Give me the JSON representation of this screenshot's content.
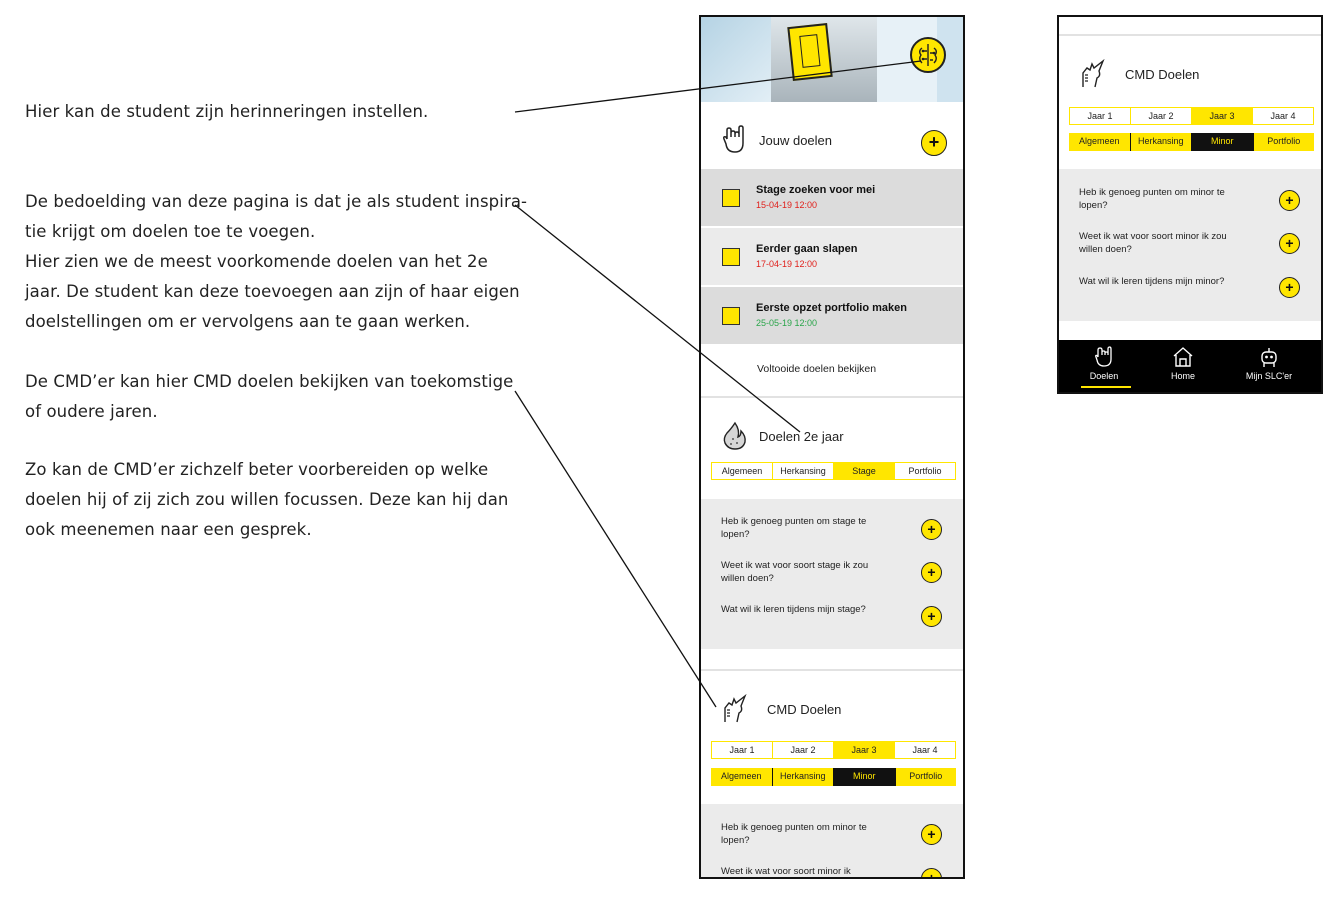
{
  "notes": {
    "n1": [
      "Hier kan de student zijn herinneringen instellen."
    ],
    "n2": [
      "De bedoelding van deze pagina is dat je als student inspira-",
      "tie krijgt om doelen toe te voegen.",
      "Hier zien we de meest voorkomende doelen van het 2e",
      "jaar. De student kan deze toevoegen aan zijn of haar eigen",
      "doelstellingen om er vervolgens aan te gaan werken."
    ],
    "n3": [
      "De CMD’er kan hier CMD doelen bekijken van toekomstige",
      "of oudere jaren."
    ],
    "n4": [
      "Zo kan de CMD’er zichzelf beter voorbereiden op welke",
      "doelen hij of zij zich zou willen focussen. Deze kan hij dan",
      "ook meenemen naar een gesprek."
    ]
  },
  "main": {
    "jouw_doelen": {
      "title": "Jouw doelen",
      "add": "+",
      "goals": [
        {
          "title": "Stage zoeken voor mei",
          "date": "15-04-19 12:00",
          "date_color": "red"
        },
        {
          "title": "Eerder gaan slapen",
          "date": "17-04-19 12:00",
          "date_color": "red"
        },
        {
          "title": "Eerste opzet portfolio maken",
          "date": "25-05-19 12:00",
          "date_color": "green"
        }
      ],
      "completed_link": "Voltooide doelen bekijken"
    },
    "doelen_2e_jaar": {
      "title": "Doelen 2e jaar",
      "tabs": [
        "Algemeen",
        "Herkansing",
        "Stage",
        "Portfolio"
      ],
      "active_tab": "Stage",
      "questions": [
        {
          "text": "Heb ik genoeg punten om stage te lopen?",
          "add": "+"
        },
        {
          "text": "Weet ik wat voor soort  stage ik zou willen doen?",
          "add": "+"
        },
        {
          "text": "Wat wil ik leren tijdens mijn stage?",
          "add": "+"
        }
      ]
    },
    "cmd_doelen": {
      "title": "CMD Doelen",
      "years": [
        "Jaar 1",
        "Jaar 2",
        "Jaar 3",
        "Jaar 4"
      ],
      "active_year": "Jaar 3",
      "tabs": [
        "Algemeen",
        "Herkansing",
        "Minor",
        "Portfolio"
      ],
      "active_tab": "Minor",
      "questions": [
        {
          "text": "Heb ik genoeg punten om minor te lopen?",
          "add": "+"
        },
        {
          "text": "Weet ik wat voor soort  minor ik",
          "add": "+"
        }
      ]
    }
  },
  "side": {
    "cmd_doelen": {
      "title": "CMD Doelen",
      "years": [
        "Jaar 1",
        "Jaar 2",
        "Jaar 3",
        "Jaar 4"
      ],
      "active_year": "Jaar 3",
      "tabs": [
        "Algemeen",
        "Herkansing",
        "Minor",
        "Portfolio"
      ],
      "active_tab": "Minor",
      "questions": [
        {
          "text": "Heb ik genoeg punten om minor te lopen?",
          "add": "+"
        },
        {
          "text": "Weet ik wat voor soort  minor ik zou willen doen?",
          "add": "+"
        },
        {
          "text": "Wat wil ik leren tijdens mijn minor?",
          "add": "+"
        }
      ]
    },
    "nav": [
      {
        "label": "Doelen",
        "icon": "rock-hand-icon",
        "active": true
      },
      {
        "label": "Home",
        "icon": "house-icon",
        "active": false
      },
      {
        "label": "Mijn SLC'er",
        "icon": "robot-icon",
        "active": false
      }
    ]
  },
  "colors": {
    "accent": "#ffe600",
    "dark": "#111111",
    "grey_row": "#ebebeb",
    "red": "#e0201b",
    "green": "#2aa54a"
  }
}
